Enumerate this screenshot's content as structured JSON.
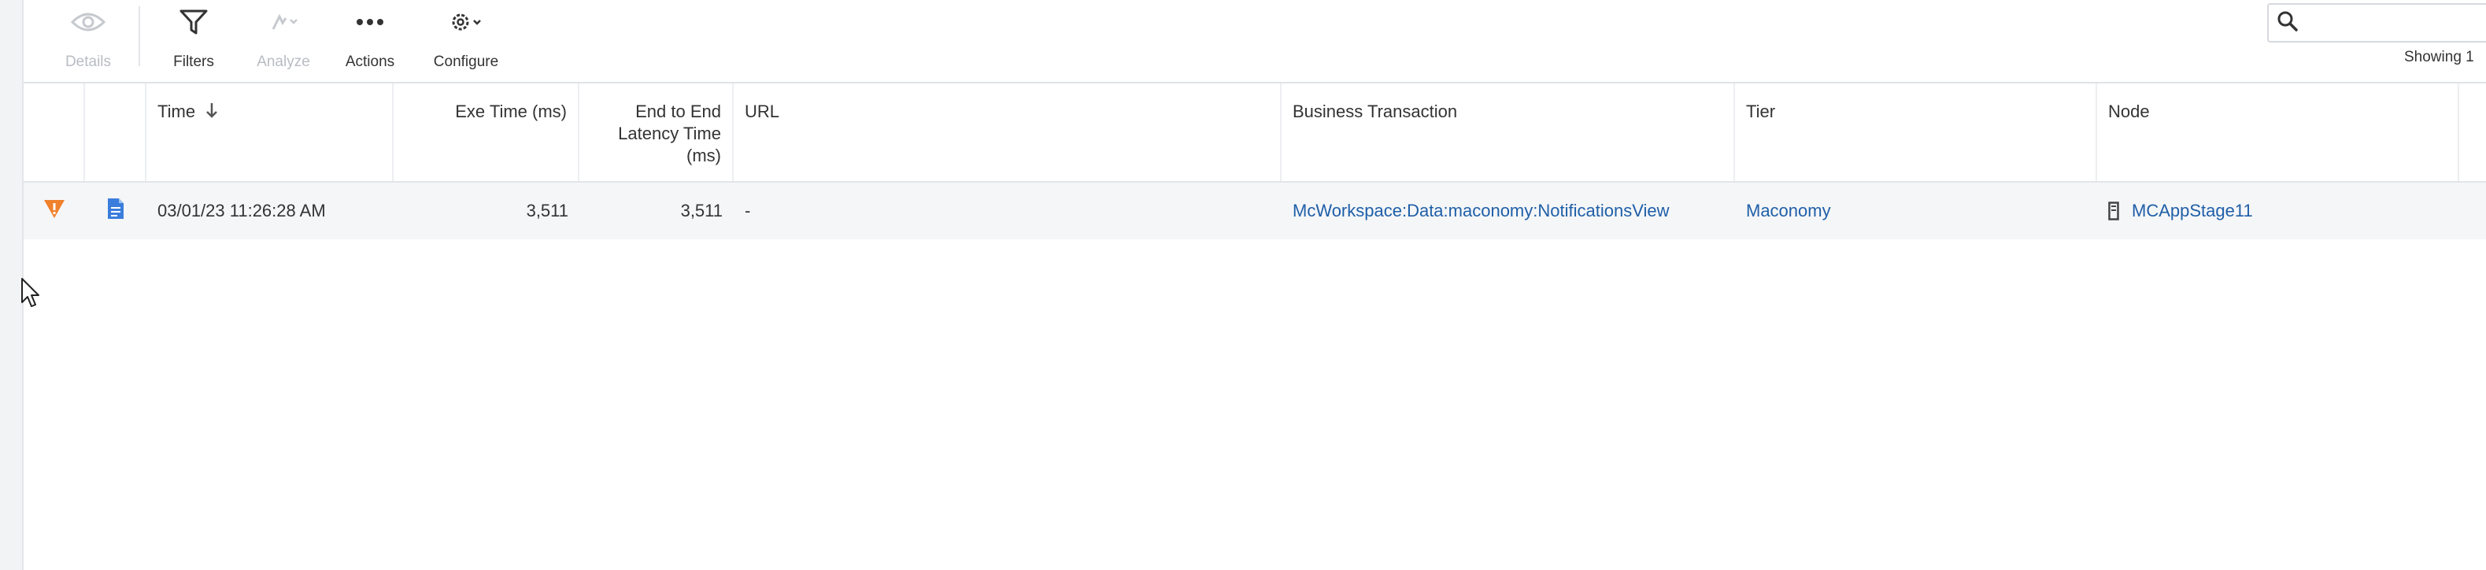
{
  "toolbar": {
    "details_label": "Details",
    "filters_label": "Filters",
    "analyze_label": "Analyze",
    "actions_label": "Actions",
    "configure_label": "Configure"
  },
  "search": {
    "value": "",
    "placeholder": ""
  },
  "showing_text": "Showing 1",
  "columns": {
    "time": "Time",
    "exe_time": "Exe Time (ms)",
    "e2e_line1": "End to End",
    "e2e_line2": "Latency Time",
    "e2e_line3": "(ms)",
    "url": "URL",
    "business_transaction": "Business Transaction",
    "tier": "Tier",
    "node": "Node"
  },
  "rows": [
    {
      "severity_icon": "warning-triangle-icon",
      "doc_icon": "document-icon",
      "time": "03/01/23 11:26:28 AM",
      "exe_time": "3,511",
      "e2e_latency": "3,511",
      "url": "-",
      "business_transaction": "McWorkspace:Data:maconomy:NotificationsView",
      "tier": "Maconomy",
      "node_icon": "server-node-icon",
      "node": "MCAppStage11"
    }
  ],
  "colors": {
    "link": "#1f5fa8",
    "warning": "#f0812c",
    "doc": "#3b7ddd"
  }
}
